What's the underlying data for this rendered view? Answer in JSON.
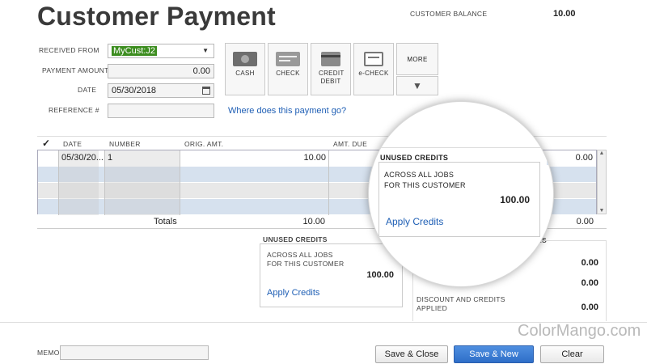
{
  "header": {
    "title": "Customer Payment",
    "balance_label": "CUSTOMER BALANCE",
    "balance_value": "10.00"
  },
  "form": {
    "received_from_label": "RECEIVED FROM",
    "received_from_value": "MyCust:J2",
    "payment_amount_label": "PAYMENT AMOUNT",
    "payment_amount_value": "0.00",
    "date_label": "DATE",
    "date_value": "05/30/2018",
    "reference_label": "REFERENCE #",
    "reference_value": ""
  },
  "payment_methods": [
    {
      "label": "CASH",
      "icon": "cash-icon"
    },
    {
      "label": "CHECK",
      "icon": "check-icon"
    },
    {
      "label": "CREDIT DEBIT",
      "icon": "credit-card-icon"
    },
    {
      "label": "e-CHECK",
      "icon": "echeck-icon"
    }
  ],
  "more_label": "MORE",
  "where_link": "Where does this payment go?",
  "table": {
    "check_header": "✓",
    "columns": [
      "DATE",
      "NUMBER",
      "ORIG. AMT.",
      "AMT. DUE"
    ],
    "rows": [
      {
        "date": "05/30/20...",
        "number": "1",
        "orig_amt": "10.00",
        "payment": "0.00"
      }
    ],
    "totals_label": "Totals",
    "totals_orig": "10.00",
    "totals_payment": "0.00"
  },
  "credits_panel": {
    "title": "UNUSED CREDITS",
    "subtitle_line1": "ACROSS ALL JOBS",
    "subtitle_line2": "FOR THIS CUSTOMER",
    "amount": "100.00",
    "link": "Apply Credits"
  },
  "magnified_panel": {
    "title": "UNUSED CREDITS",
    "subtitle_line1": "ACROSS ALL JOBS",
    "subtitle_line2": "FOR THIS CUSTOMER",
    "amount": "100.00",
    "link": "Apply Credits"
  },
  "summary": {
    "heading_fragment": "ES",
    "value1": "0.00",
    "value2": "0.00",
    "discount_line1": "DISCOUNT AND CREDITS",
    "discount_line2": "APPLIED",
    "discount_value": "0.00"
  },
  "footer": {
    "memo_label": "MEMO",
    "memo_value": "",
    "save_close": "Save & Close",
    "save_new": "Save & New",
    "clear": "Clear"
  },
  "watermark": "ColorMango.com",
  "colors": {
    "accent": "#2e6ec8",
    "selected_customer_bg": "#3c8d1f",
    "row_alt": "#d6e1ee",
    "link": "#1f5fb5"
  }
}
